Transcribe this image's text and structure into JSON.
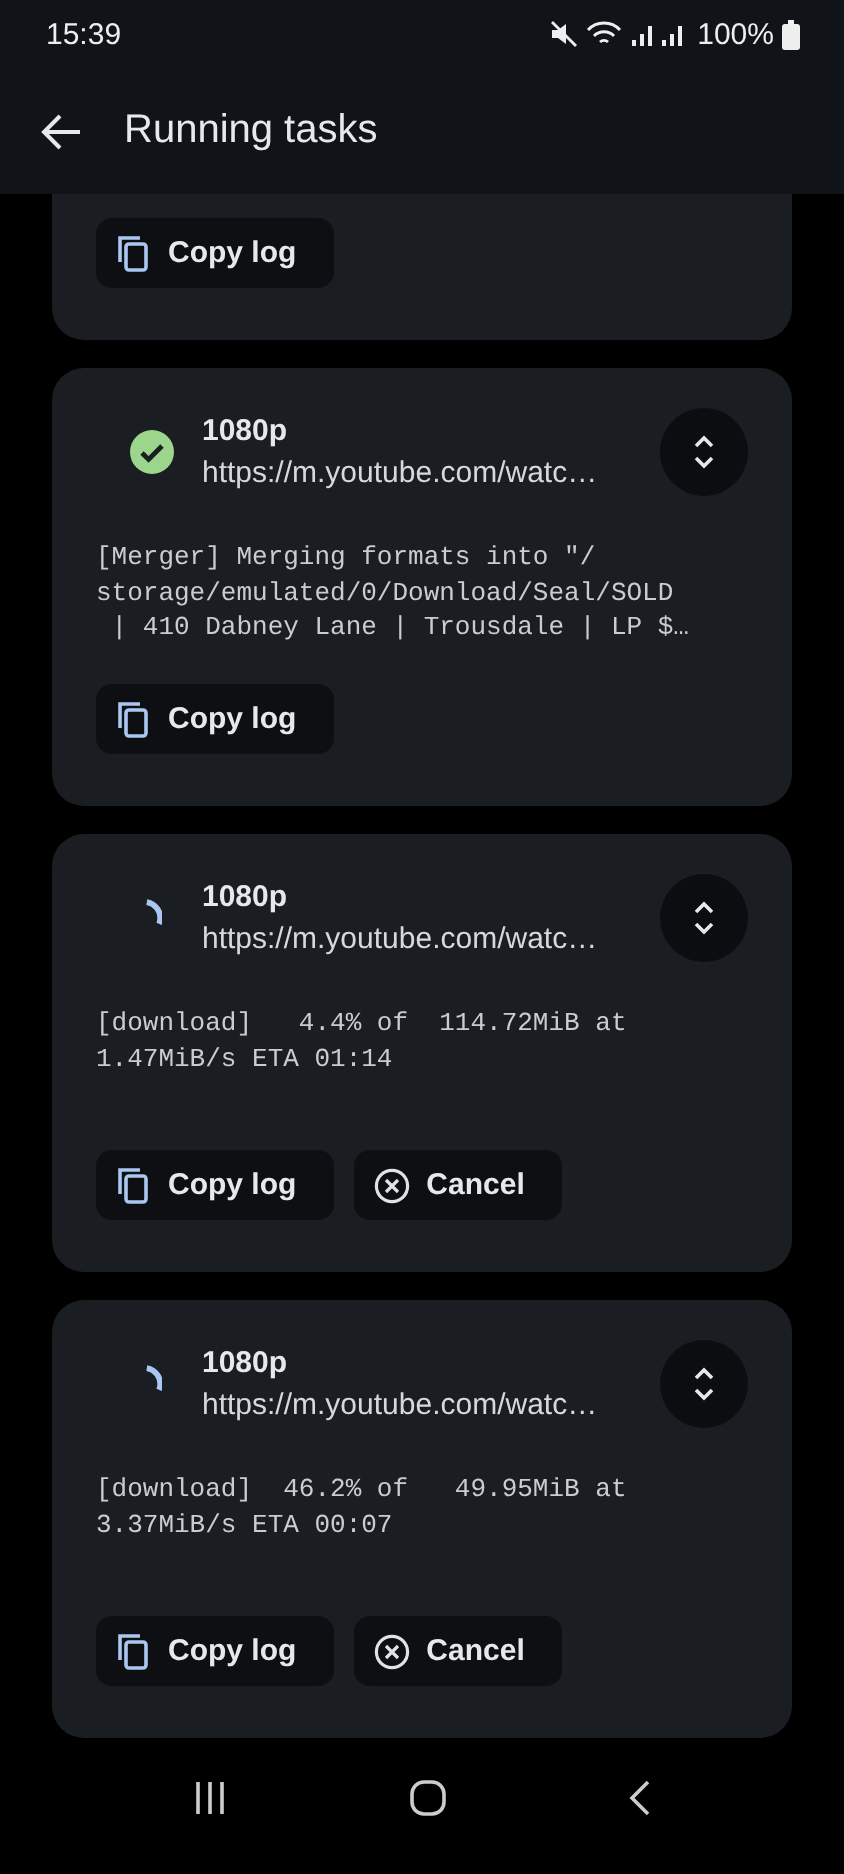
{
  "status_bar": {
    "time": "15:39",
    "battery": "100%"
  },
  "app_bar": {
    "title": "Running tasks"
  },
  "tasks": [
    {
      "actions": [
        {
          "kind": "copy",
          "label": "Copy log"
        }
      ]
    },
    {
      "kind": "finished",
      "title": "1080p",
      "url": "https://m.youtube.com/watc…",
      "log_lines": [
        "[Merger] Merging formats into \"/",
        "storage/emulated/0/Download/Seal/SOLD",
        " | 410 Dabney Lane | Trousdale | LP $…"
      ],
      "actions": [
        {
          "kind": "copy",
          "label": "Copy log"
        }
      ]
    },
    {
      "kind": "progress",
      "title": "1080p",
      "url": "https://m.youtube.com/watc…",
      "log_lines": [
        "[download]   4.4% of  114.72MiB at",
        "1.47MiB/s ETA 01:14"
      ],
      "actions": [
        {
          "kind": "copy",
          "label": "Copy log"
        },
        {
          "kind": "cancel",
          "label": "Cancel"
        }
      ]
    },
    {
      "kind": "progress",
      "title": "1080p",
      "url": "https://m.youtube.com/watc…",
      "log_lines": [
        "[download]  46.2% of   49.95MiB at",
        "3.37MiB/s ETA 00:07"
      ],
      "actions": [
        {
          "kind": "copy",
          "label": "Copy log"
        },
        {
          "kind": "cancel",
          "label": "Cancel"
        }
      ]
    }
  ]
}
